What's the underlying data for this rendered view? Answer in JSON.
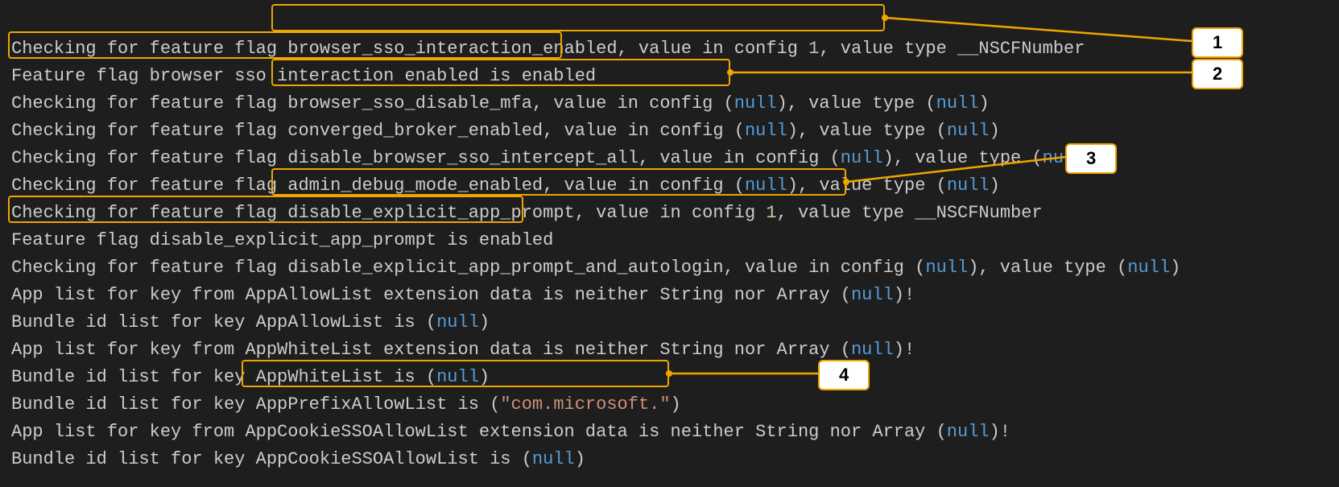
{
  "log": {
    "l1_pre": "Checking for feature flag ",
    "l1_hl_a": "browser_sso_interaction_enabled, value in config ",
    "l1_hl_num": "1",
    "l1_post": ", value type __NSCFNumber",
    "l2_hl": "Feature flag browser sso interaction enabled is enabled",
    "l3_pre": "Checking for feature flag ",
    "l3_hl_a": "browser_sso_disable_mfa, value in config (",
    "l3_hl_null": "null",
    "l3_hl_b": ")",
    "l3_post_a": ", value type (",
    "l3_post_null": "null",
    "l3_post_b": ")",
    "l4_a": "Checking for feature flag converged_broker_enabled, value in config (",
    "l4_null1": "null",
    "l4_b": "), value type (",
    "l4_null2": "null",
    "l4_c": ")",
    "l5_a": "Checking for feature flag disable_browser_sso_intercept_all, value in config (",
    "l5_null1": "null",
    "l5_b": "), value type (",
    "l5_null2": "null",
    "l5_c": ")",
    "l6_a": "Checking for feature flag admin_debug_mode_enabled, value in config (",
    "l6_null1": "null",
    "l6_b": "), value type (",
    "l6_null2": "null",
    "l6_c": ")",
    "l7_pre": "Checking for feature flag ",
    "l7_hl_a": "disable_explicit_app_prompt, value in config ",
    "l7_hl_num": "1",
    "l7_post": ", value type __NSCFNumber",
    "l8_hl": "Feature flag disable_explicit_app_prompt is enabled",
    "l9_a": "Checking for feature flag disable_explicit_app_prompt_and_autologin, value in config (",
    "l9_null1": "null",
    "l9_b": "), value type (",
    "l9_null2": "null",
    "l9_c": ")",
    "l10_a": "App list for key from AppAllowList extension data is neither String nor Array (",
    "l10_null": "null",
    "l10_b": ")!",
    "l11_a": "Bundle id list for key AppAllowList is (",
    "l11_null": "null",
    "l11_b": ")",
    "l12_a": "App list for key from AppWhiteList extension data is neither String nor Array (",
    "l12_null": "null",
    "l12_b": ")!",
    "l13_a": "Bundle id list for key AppWhiteList is (",
    "l13_null": "null",
    "l13_b": ")",
    "l14_pre": "Bundle id list for key ",
    "l14_hl_a": "AppPrefixAllowList is (",
    "l14_hl_str": "\"com.microsoft.\"",
    "l14_hl_b": ")",
    "l15_a": "App list for key from AppCookieSSOAllowList extension data is neither String nor Array (",
    "l15_null": "null",
    "l15_b": ")!",
    "l16_a": "Bundle id list for key AppCookieSSOAllowList is (",
    "l16_null": "null",
    "l16_b": ")"
  },
  "callouts": {
    "c1": "1",
    "c2": "2",
    "c3": "3",
    "c4": "4"
  }
}
